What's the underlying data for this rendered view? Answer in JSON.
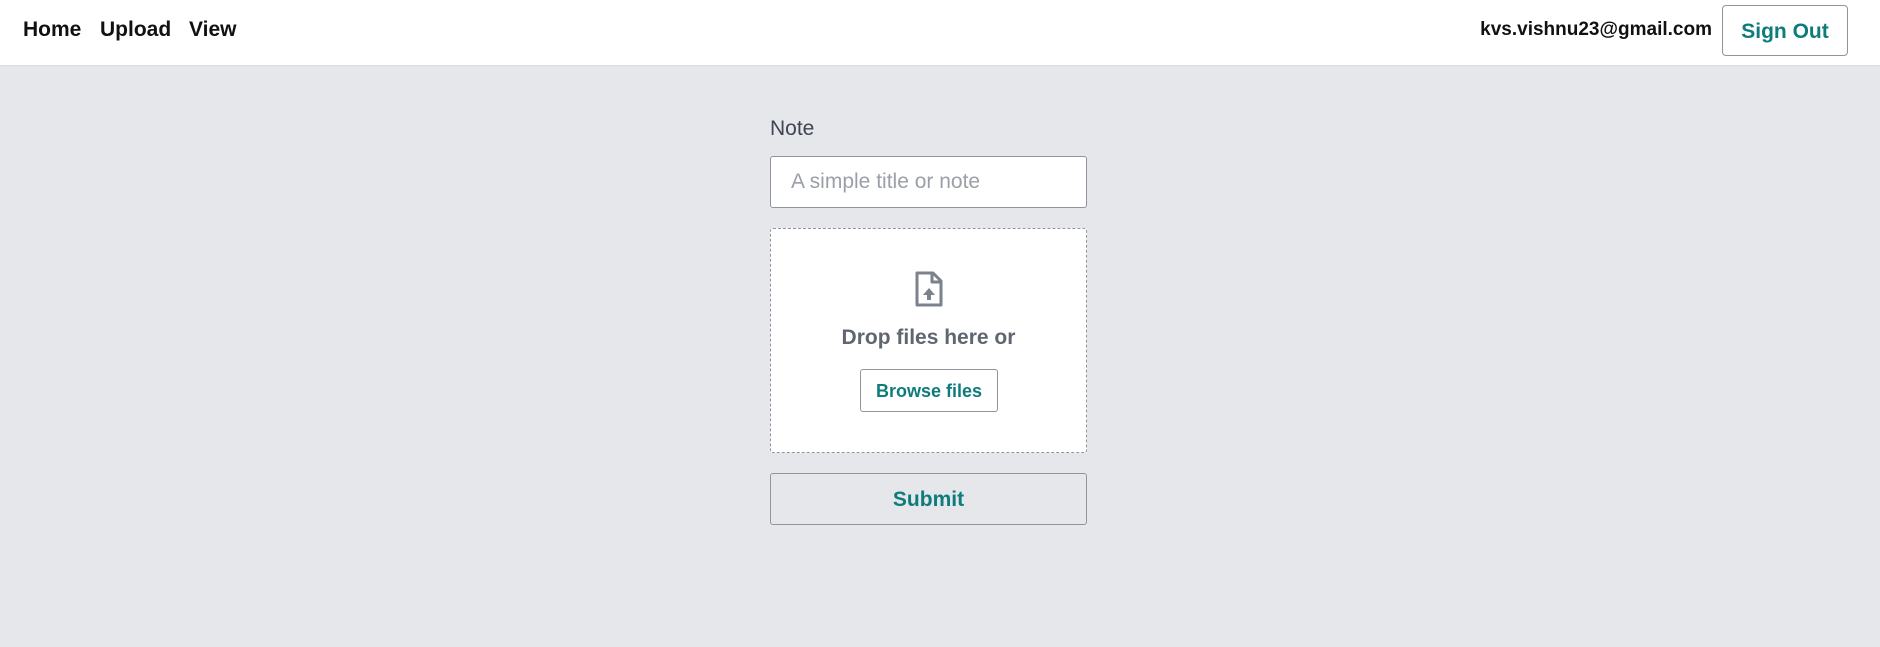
{
  "nav": {
    "items": [
      {
        "label": "Home"
      },
      {
        "label": "Upload"
      },
      {
        "label": "View"
      }
    ]
  },
  "user": {
    "email": "kvs.vishnu23@gmail.com",
    "sign_out_label": "Sign Out"
  },
  "form": {
    "note_label": "Note",
    "note_value": "",
    "note_placeholder": "A simple title or note",
    "dropzone": {
      "icon": "file-upload-icon",
      "text": "Drop files here or",
      "browse_label": "Browse files"
    },
    "submit_label": "Submit"
  },
  "colors": {
    "page_background": "#e5e7eb",
    "accent": "#0e7c7b",
    "border": "#8f959e",
    "muted_text": "#5f6670"
  }
}
